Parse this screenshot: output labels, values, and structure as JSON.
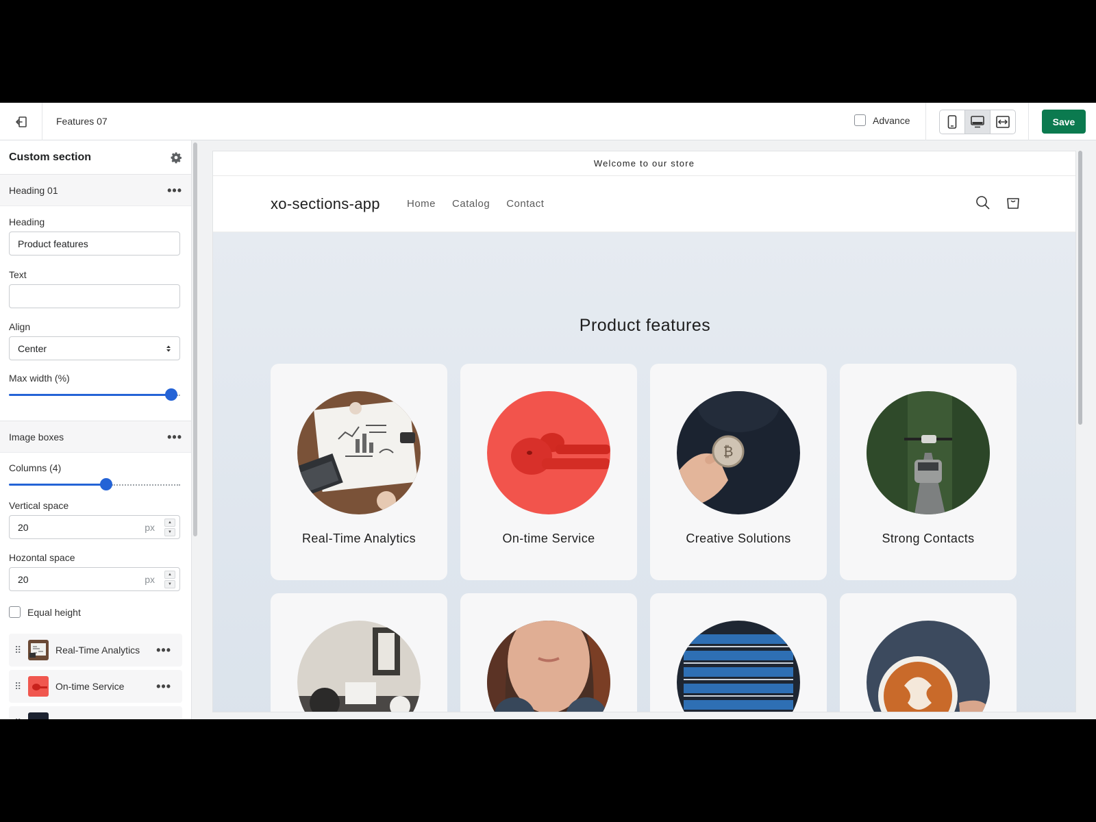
{
  "topbar": {
    "page_name": "Features 07",
    "advance_label": "Advance",
    "save_label": "Save"
  },
  "sidebar": {
    "title": "Custom section",
    "heading_group": {
      "title": "Heading 01",
      "heading_label": "Heading",
      "heading_value": "Product features",
      "text_label": "Text",
      "text_value": "",
      "align_label": "Align",
      "align_value": "Center",
      "max_width_label": "Max width (%)",
      "max_width_level": 1.0
    },
    "image_boxes": {
      "title": "Image boxes",
      "columns_label": "Columns (4)",
      "columns_level": 0.6,
      "vertical_label": "Vertical space",
      "vertical_value": "20",
      "horizontal_label": "Hozontal space",
      "horizontal_value": "20",
      "unit": "px",
      "equal_height_label": "Equal height"
    },
    "blocks": [
      {
        "label": "Real-Time Analytics"
      },
      {
        "label": "On-time Service"
      }
    ]
  },
  "preview": {
    "announcement": "Welcome to our store",
    "logo": "xo-sections-app",
    "nav": [
      "Home",
      "Catalog",
      "Contact"
    ],
    "section_title": "Product features",
    "cards": [
      {
        "title": "Real-Time Analytics",
        "image": "analytics-desk-photo"
      },
      {
        "title": "On-time Service",
        "image": "red-earbuds-photo"
      },
      {
        "title": "Creative Solutions",
        "image": "bitcoin-coin-photo"
      },
      {
        "title": "Strong Contacts",
        "image": "drone-car-photo"
      },
      {
        "title": "",
        "image": "office-desk-photo"
      },
      {
        "title": "",
        "image": "headphones-woman-photo"
      },
      {
        "title": "",
        "image": "server-rack-photo"
      },
      {
        "title": "",
        "image": "latte-art-photo"
      }
    ]
  },
  "colors": {
    "accent": "#2463d6",
    "save": "#0b7a4f",
    "hero_bg": "#dfe6ee"
  }
}
